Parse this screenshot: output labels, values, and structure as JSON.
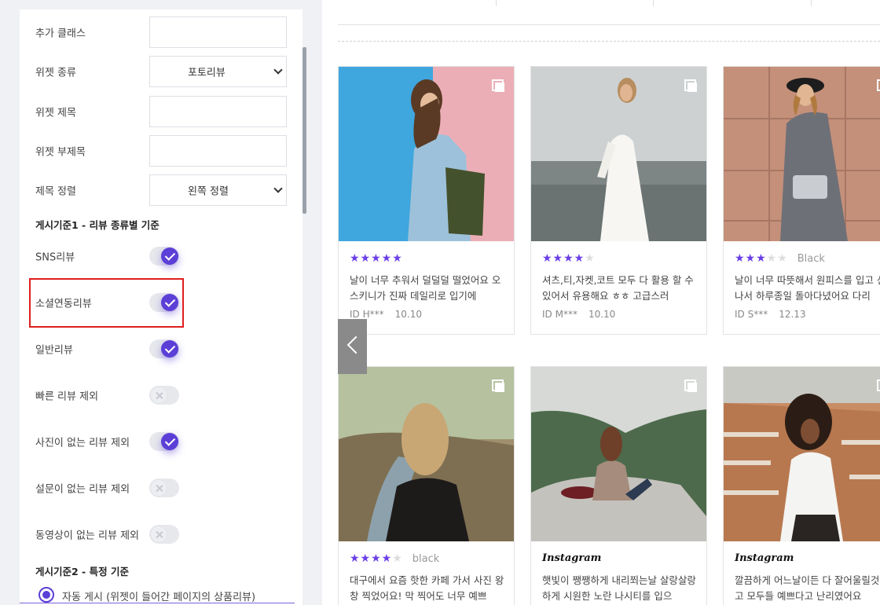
{
  "settings": {
    "extra_class_label": "추가 클래스",
    "widget_type_label": "위젯 종류",
    "widget_type_value": "포토리뷰",
    "widget_title_label": "위젯 제목",
    "widget_subtitle_label": "위젯 부제목",
    "title_align_label": "제목 정렬",
    "title_align_value": "왼쪽 정렬",
    "criteria1_title": "게시기준1 - 리뷰 종류별 기준",
    "toggles": [
      {
        "label": "SNS리뷰",
        "on": true
      },
      {
        "label": "소셜연동리뷰",
        "on": true
      },
      {
        "label": "일반리뷰",
        "on": true
      },
      {
        "label": "빠른 리뷰 제외",
        "on": false
      },
      {
        "label": "사진이 없는 리뷰 제외",
        "on": true
      },
      {
        "label": "설문이 없는 리뷰 제외",
        "on": false
      },
      {
        "label": "동영상이 없는 리뷰 제외",
        "on": false
      }
    ],
    "criteria2_title": "게시기준2 - 특정 기준",
    "radio_auto_label": "자동 게시 (위젯이 들어간 페이지의 상품리뷰)"
  },
  "reviews": [
    {
      "rating": 5,
      "option": "",
      "text": "날이 너무 추워서 덜덜덜 떨었어요 오 스키니가 진짜 데일리로 입기에",
      "user": "ID H***",
      "date": "10.10"
    },
    {
      "rating": 4,
      "option": "",
      "text": "셔츠,티,자켓,코트 모두 다 활용 할 수 있어서 유용해요 ㅎㅎ 고급스러",
      "user": "ID M***",
      "date": "10.10"
    },
    {
      "rating": 3,
      "option": "Black",
      "text": "날이 너무 따뜻해서 원피스를 입고 신나서 하루종일 돌아다녔어요 다리",
      "user": "ID S***",
      "date": "12.13"
    },
    {
      "rating": 4,
      "option": "black",
      "text": "대구에서 요즘 핫한 카페 가서 사진 왕창 찍었어요! 막 찍어도 너무 예쁘",
      "user": "",
      "date": ""
    },
    {
      "source": "Instagram",
      "text": "햇빛이 쨍쨍하게 내리쬐는날 살랑살랑하게 시원한 노란 나시티를 입으",
      "user": "",
      "date": ""
    },
    {
      "source": "Instagram",
      "text": "깔끔하게 어느날이든 다 잘어울릴것 같고 모두들 예쁘다고 난리였어요",
      "user": "",
      "date": ""
    }
  ],
  "colors": {
    "accent": "#5b3fd6",
    "star": "#6a3ee6",
    "highlight": "#e01e1e"
  }
}
